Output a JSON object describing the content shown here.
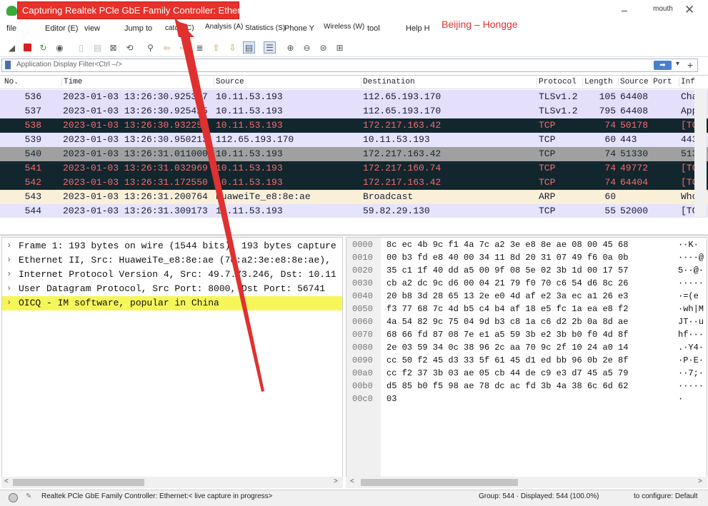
{
  "window": {
    "title": "Capturing Realtek PCle GbE Family Controller: Etherne",
    "user_label": "mouth",
    "minimize_glyph": "–",
    "close_glyph": "✕"
  },
  "menu": {
    "items": [
      "file",
      "Editor (E)",
      "view",
      "Jump to",
      "catch (C)",
      "Analysis (A)",
      "Statistics (S)",
      "Phone Y",
      "Wireless (W)",
      "tool",
      "Help H"
    ]
  },
  "overlay_label": "Beijing – Hongge",
  "filter": {
    "placeholder": "Application Display Filter<Ctrl –/>"
  },
  "packet_list": {
    "columns": [
      "No.",
      "Time",
      "Source",
      "Destination",
      "Protocol",
      "Length",
      "Source Port",
      "Inf"
    ],
    "rows": [
      {
        "no": "536",
        "time": "2023-01-03 13:26:30.925317",
        "source": "10.11.53.193",
        "destination": "112.65.193.170",
        "protocol": "TLSv1.2",
        "length": "105",
        "port": "64408",
        "info": "Cha",
        "style": "tls"
      },
      {
        "no": "537",
        "time": "2023-01-03 13:26:30.925425",
        "source": "10.11.53.193",
        "destination": "112.65.193.170",
        "protocol": "TLSv1.2",
        "length": "795",
        "port": "64408",
        "info": "App",
        "style": "tls"
      },
      {
        "no": "538",
        "time": "2023-01-03 13:26:30.932254",
        "source": "10.11.53.193",
        "destination": "172.217.163.42",
        "protocol": "TCP",
        "length": "74",
        "port": "50178",
        "info": "[TC",
        "style": "tcpbad"
      },
      {
        "no": "539",
        "time": "2023-01-03 13:26:30.950213",
        "source": "112.65.193.170",
        "destination": "10.11.53.193",
        "protocol": "TCP",
        "length": "60",
        "port": "443",
        "info": "443",
        "style": "tcp"
      },
      {
        "no": "540",
        "time": "2023-01-03 13:26:31.011000",
        "source": "10.11.53.193",
        "destination": "172.217.163.42",
        "protocol": "TCP",
        "length": "74",
        "port": "51330",
        "info": "513",
        "style": "gray"
      },
      {
        "no": "541",
        "time": "2023-01-03 13:26:31.032969",
        "source": "10.11.53.193",
        "destination": "172.217.160.74",
        "protocol": "TCP",
        "length": "74",
        "port": "49772",
        "info": "[TC",
        "style": "tcpbad"
      },
      {
        "no": "542",
        "time": "2023-01-03 13:26:31.172550",
        "source": "10.11.53.193",
        "destination": "172.217.163.42",
        "protocol": "TCP",
        "length": "74",
        "port": "64404",
        "info": "[TC",
        "style": "tcpbad"
      },
      {
        "no": "543",
        "time": "2023-01-03 13:26:31.200764",
        "source": "HuaweiTe_e8:8e:ae",
        "destination": "Broadcast",
        "protocol": "ARP",
        "length": "60",
        "port": "",
        "info": "Who",
        "style": "arp"
      },
      {
        "no": "544",
        "time": "2023-01-03 13:26:31.309173",
        "source": "10.11.53.193",
        "destination": "59.82.29.130",
        "protocol": "TCP",
        "length": "55",
        "port": "52000",
        "info": "[TC",
        "style": "tcp"
      }
    ]
  },
  "details": {
    "rows": [
      {
        "text": "Frame 1: 193 bytes on wire (1544 bits), 193 bytes capture",
        "highlight": false
      },
      {
        "text": "Ethernet II, Src: HuaweiTe_e8:8e:ae (7c:a2:3e:e8:8e:ae),",
        "highlight": false
      },
      {
        "text": "Internet Protocol Version 4, Src: 49.7.73.246, Dst: 10.11",
        "highlight": false
      },
      {
        "text": "User Datagram Protocol, Src Port: 8000, Dst Port: 56741",
        "highlight": false
      },
      {
        "text": "OICQ - IM software, popular in China",
        "highlight": true
      }
    ]
  },
  "bytes": {
    "rows": [
      {
        "offset": "0000",
        "hex": "8c ec 4b 9c f1 4a 7c a2  3e e8 8e ae 08 00 45 68",
        "ascii": "··K·"
      },
      {
        "offset": "0010",
        "hex": "00 b3 fd e8 40 00 34 11  8d 20 31 07 49 f6 0a 0b",
        "ascii": "····@"
      },
      {
        "offset": "0020",
        "hex": "35 c1 1f 40 dd a5 00 9f  08 5e 02 3b 1d 00 17 57",
        "ascii": "5··@·"
      },
      {
        "offset": "0030",
        "hex": "cb a2 dc 9c d6 00 04 21  79 f0 70 c6 54 d6 8c 26",
        "ascii": "·····"
      },
      {
        "offset": "0040",
        "hex": "20 b8 3d 28 65 13 2e e0  4d af e2 3a ec a1 26 e3",
        "ascii": " ·=(e"
      },
      {
        "offset": "0050",
        "hex": "f3 77 68 7c 4d b5 c4 b4  af 18 e5 fc 1a ea e8 f2",
        "ascii": "·wh|M"
      },
      {
        "offset": "0060",
        "hex": "4a 54 82 9c 75 04 9d b3  c8 1a c6 d2 2b 0a 8d ae",
        "ascii": "JT··u"
      },
      {
        "offset": "0070",
        "hex": "68 66 fd 87 08 7e e1 a5  59 3b e2 3b b0 f0 4d 8f",
        "ascii": "hf···"
      },
      {
        "offset": "0080",
        "hex": "2e 03 59 34 0c 38 96 2c  aa 70 9c 2f 10 24 a0 14",
        "ascii": ".·Y4·"
      },
      {
        "offset": "0090",
        "hex": "cc 50 f2 45 d3 33 5f 61  45 d1 ed bb 96 0b 2e 8f",
        "ascii": "·P·E·"
      },
      {
        "offset": "00a0",
        "hex": "cc f2 37 3b 03 ae 05 cb  44 de c9 e3 d7 45 a5 79",
        "ascii": "··7;·"
      },
      {
        "offset": "00b0",
        "hex": "d5 85 b0 f5 98 ae 78 dc  ac fd 3b 4a 38 6c 6d 62",
        "ascii": "·····"
      },
      {
        "offset": "00c0",
        "hex": "03",
        "ascii": "·"
      }
    ]
  },
  "status": {
    "interface": "Realtek PCle GbE Family Controller:  Ethernet:< live capture in progress>",
    "counts": "Group: 544 · Displayed: 544 (100.0%)",
    "profile": "to configure: Default"
  },
  "colors": {
    "title_highlight": "#e8312a",
    "annotation_red": "#e03030",
    "bad_tcp_bg": "#12262e",
    "bad_tcp_fg": "#f46c6c",
    "highlight_yellow": "#f6f65a"
  },
  "icons": [
    "shark-fin-icon",
    "stop-icon",
    "restart-icon",
    "options-gear-icon",
    "open-file-icon",
    "save-file-icon",
    "close-file-icon",
    "reload-icon",
    "find-icon",
    "back-icon",
    "forward-icon",
    "goto-icon",
    "first-icon",
    "last-icon",
    "autoscroll-icon",
    "colorize-icon",
    "zoom-in-icon",
    "zoom-out-icon",
    "zoom-normal-icon",
    "resize-columns-icon"
  ]
}
